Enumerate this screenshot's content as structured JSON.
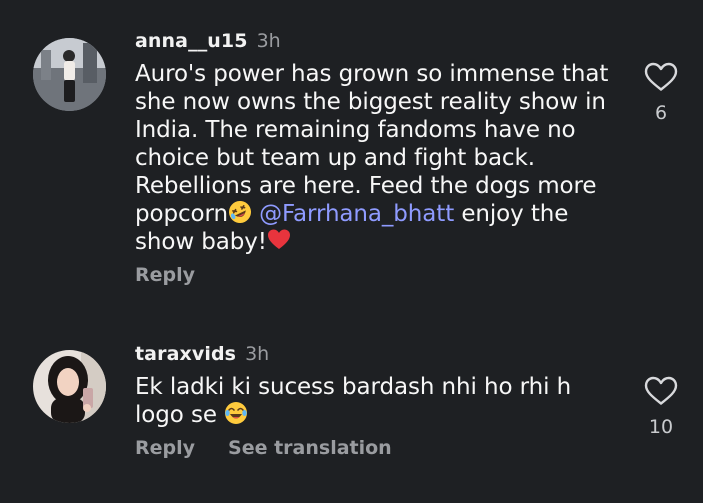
{
  "comments": [
    {
      "username": "anna__u15",
      "time": "3h",
      "text_part1": "Auro's power has grown so immense that she now owns the biggest reality show in India. The remaining fandoms have no choice but team up and fight back. Rebellions are here. Feed the dogs more popcorn",
      "emoji1": "rolling-on-floor-laughing",
      "mention": "@Farrhana_bhatt",
      "text_part2": " enjoy the show baby!",
      "emoji2": "red-heart",
      "reply_label": "Reply",
      "like_count": "6"
    },
    {
      "username": "taraxvids",
      "time": "3h",
      "text": "Ek ladki ki sucess bardash nhi ho rhi h logo se ",
      "emoji1": "face-with-tears-of-joy",
      "reply_label": "Reply",
      "see_translation_label": "See translation",
      "like_count": "10"
    }
  ],
  "colors": {
    "background": "#1e2023",
    "text": "#f7f7f7",
    "muted": "#9a9ca0",
    "mention": "#8f9bff"
  }
}
